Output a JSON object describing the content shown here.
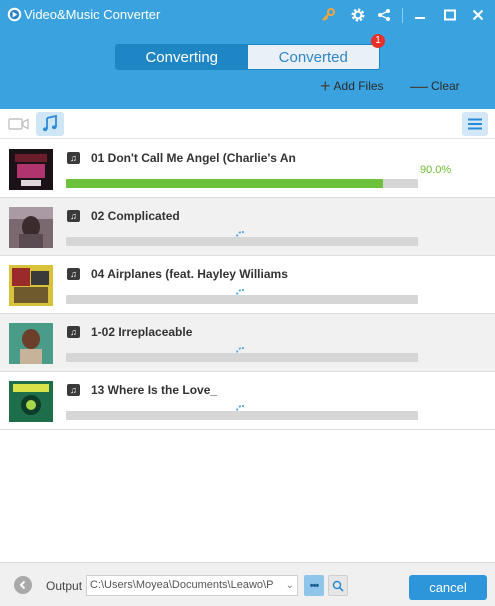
{
  "app": {
    "title": "Video&Music Converter"
  },
  "titlebar": {
    "icons": [
      "key-icon",
      "gear-icon",
      "share-icon",
      "minimize-icon",
      "maximize-icon",
      "close-icon"
    ]
  },
  "tabs": {
    "converting": "Converting",
    "converted": "Converted",
    "converted_badge": "1"
  },
  "actions": {
    "add_files": "Add Files",
    "clear": "Clear"
  },
  "colors": {
    "header": "#3aa3df",
    "tab_active": "#1f86c6",
    "progress": "#6cc23a",
    "badge": "#e8302a",
    "cancel": "#2d96da"
  },
  "tracks": [
    {
      "title": "01 Don't Call Me Angel (Charlie's An",
      "progress": 90.0,
      "percent_label": "90.0%",
      "status": "converting"
    },
    {
      "title": "02 Complicated",
      "progress": 0,
      "status": "waiting"
    },
    {
      "title": "04 Airplanes (feat. Hayley Williams",
      "progress": 0,
      "status": "waiting"
    },
    {
      "title": "1-02 Irreplaceable",
      "progress": 0,
      "status": "waiting"
    },
    {
      "title": "13 Where Is the Love_",
      "progress": 0,
      "status": "waiting"
    }
  ],
  "footer": {
    "output_label": "Output",
    "output_path": "C:\\Users\\Moyea\\Documents\\Leawo\\P",
    "more_label": "•••",
    "cancel_label": "cancel"
  }
}
